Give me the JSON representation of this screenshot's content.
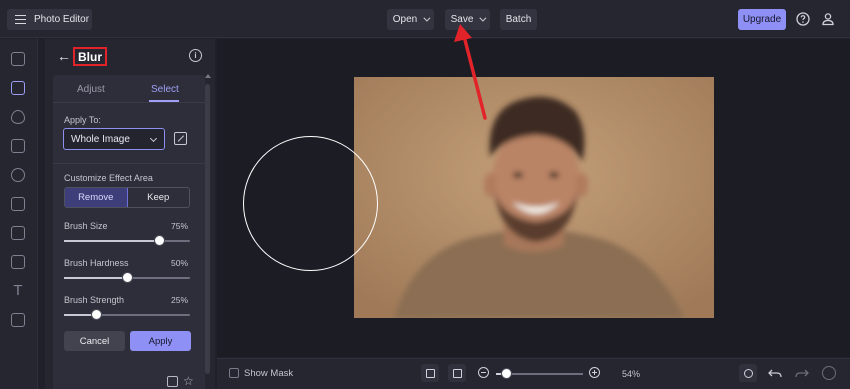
{
  "app": {
    "title": "Photo Editor"
  },
  "toolbar": {
    "open_label": "Open",
    "save_label": "Save",
    "batch_label": "Batch",
    "upgrade_label": "Upgrade"
  },
  "panel": {
    "title": "Blur",
    "tabs": [
      {
        "label": "Adjust",
        "active": false
      },
      {
        "label": "Select",
        "active": true
      }
    ],
    "apply_to_label": "Apply To:",
    "apply_to_value": "Whole Image",
    "customize_label": "Customize Effect Area",
    "mode_options": [
      {
        "label": "Remove",
        "selected": true
      },
      {
        "label": "Keep",
        "selected": false
      }
    ],
    "sliders": [
      {
        "label": "Brush Size",
        "value": 75,
        "display": "75%"
      },
      {
        "label": "Brush Hardness",
        "value": 50,
        "display": "50%"
      },
      {
        "label": "Brush Strength",
        "value": 25,
        "display": "25%"
      }
    ],
    "cancel_label": "Cancel",
    "apply_label": "Apply"
  },
  "bottom": {
    "show_mask_label": "Show Mask",
    "show_mask_checked": false,
    "zoom_value": 0.54,
    "zoom_display": "54%"
  },
  "colors": {
    "accent": "#8f90f5",
    "annotation": "#e2232a"
  }
}
